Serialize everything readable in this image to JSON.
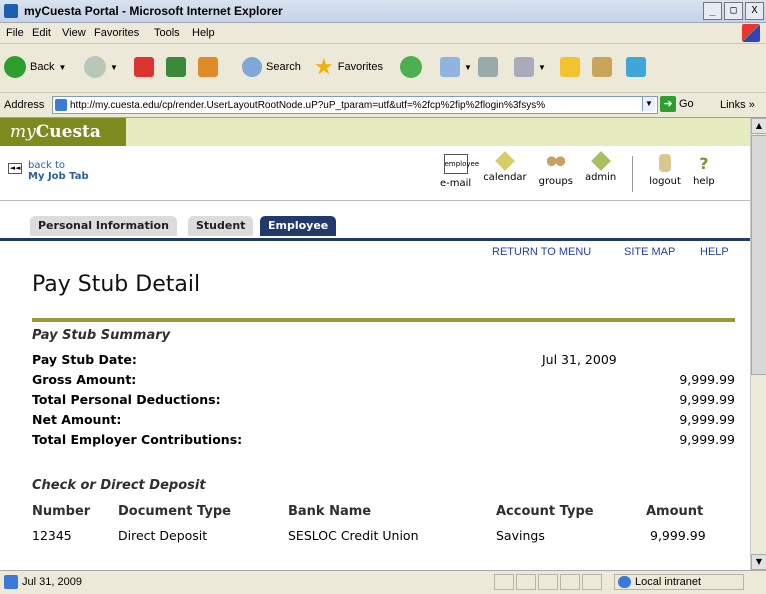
{
  "window": {
    "title": "myCuesta Portal - Microsoft Internet Explorer",
    "buttons": [
      "_",
      "□",
      "X"
    ]
  },
  "menu": [
    "File",
    "Edit",
    "View",
    "Favorites",
    "Tools",
    "Help"
  ],
  "toolbar": {
    "back": "Back",
    "search": "Search",
    "favorites": "Favorites"
  },
  "address": {
    "label": "Address",
    "url": "http://my.cuesta.edu/cp/render.UserLayoutRootNode.uP?uP_tparam=utf&utf=%2fcp%2fip%2flogin%3fsys%",
    "go": "Go",
    "links": "Links"
  },
  "portal": {
    "logo_prefix": "my",
    "logo_suffix": "Cuesta",
    "back_line1": "back to",
    "back_line2": "My Job Tab",
    "nav": [
      "e-mail",
      "calendar",
      "groups",
      "admin",
      "logout",
      "help"
    ],
    "email_icon_text": "employee"
  },
  "tabs": [
    "Personal Information",
    "Student",
    "Employee"
  ],
  "links": [
    "RETURN TO MENU",
    "SITE MAP",
    "HELP"
  ],
  "page_title": "Pay Stub Detail",
  "summary": {
    "heading": "Pay Stub Summary",
    "rows": [
      {
        "label": "Pay Stub Date:",
        "value": "Jul 31, 2009"
      },
      {
        "label": "Gross Amount:",
        "value": "9,999.99"
      },
      {
        "label": "Total Personal Deductions:",
        "value": "9,999.99"
      },
      {
        "label": "Net Amount:",
        "value": "9,999.99"
      },
      {
        "label": "Total Employer Contributions:",
        "value": "9,999.99"
      }
    ]
  },
  "deposit": {
    "heading": "Check or Direct Deposit",
    "columns": [
      "Number",
      "Document Type",
      "Bank Name",
      "Account Type",
      "Amount"
    ],
    "rows": [
      [
        "12345",
        "Direct Deposit",
        "SESLOC Credit Union",
        "Savings",
        "9,999.99"
      ]
    ]
  },
  "status": {
    "text": "Jul 31, 2009",
    "zone": "Local intranet"
  }
}
